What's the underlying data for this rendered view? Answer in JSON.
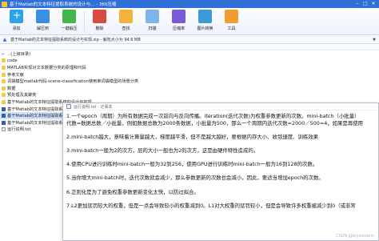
{
  "window": {
    "title": "基于Matlab的文本特征提取系统的设计与... - 360压缩",
    "controls": [
      "–",
      "□",
      "✕"
    ]
  },
  "toolbar": {
    "items": [
      {
        "label": "添加",
        "icon": "add-icon"
      },
      {
        "label": "解压到",
        "icon": "extract-icon"
      },
      {
        "label": "一键解压",
        "icon": "one-click-extract-icon"
      },
      {
        "label": "删除",
        "icon": "delete-icon"
      },
      {
        "label": "查找",
        "icon": "find-icon"
      },
      {
        "label": "扫描",
        "icon": "scan-icon"
      },
      {
        "label": "压缩率",
        "icon": "ratio-icon"
      },
      {
        "label": "图片转换",
        "icon": "image-convert-icon"
      },
      {
        "label": "工具",
        "icon": "tools-icon"
      }
    ]
  },
  "addressbar": {
    "text": "基于Matlab的文本特征提取系统的设计与实现.zip - 解包大小为 94.6 MB"
  },
  "files": [
    {
      "name": "..(上级目录)",
      "icon": "up-icon",
      "selected": false
    },
    {
      "name": "code",
      "icon": "folder-icon",
      "selected": false
    },
    {
      "name": "MATLAB实现对文本数据分类的原理和代码",
      "icon": "folder-icon",
      "selected": false
    },
    {
      "name": "参考文献",
      "icon": "folder-icon",
      "selected": false
    },
    {
      "name": "词袋模型matlab代码-scene-classification使用单词袋模型的场景分类",
      "icon": "folder-icon",
      "selected": false
    },
    {
      "name": "数据",
      "icon": "folder-icon",
      "selected": false
    },
    {
      "name": "预处理及其聚类",
      "icon": "folder-icon",
      "selected": false
    },
    {
      "name": "基于Matlab的文本特征提取系统的设计与实现",
      "icon": "folder-icon",
      "selected": false
    },
    {
      "name": "基于Matlab的文本特征提取系统的设计与实现 毕业论文.docx",
      "icon": "doc-icon",
      "selected": false
    },
    {
      "name": "基于Matlab的文本特征提取系统的设计与实现",
      "icon": "doc-icon",
      "selected": true
    },
    {
      "name": "基于Matlab的文本特征提取系统的设计与实现",
      "icon": "doc-icon",
      "selected": false
    },
    {
      "name": "运行说明.txt",
      "icon": "txt-icon",
      "selected": false
    }
  ],
  "notepad": {
    "title": "运行说明.txt - 记事本",
    "lines": [
      "1.一个epoch（周期）为所有数据完成一次前向与反向传播。iteration(迭代次数)为权重参数更新的次数。mini-batch（小批量）",
      "代数=数据总数／小批量，例如数据总数为2000条数据，小批量为500，那么一个周期内迭代次数=2000／500=4，如果是再使用",
      "",
      "2.mini-batch越大，意味着计算量越大，梯度越平滑，但不是越大越好，要根据内存大小、收敛速度、训练效果",
      "",
      "3.mini-batch一般为2的次方，层的大小一般也为2的次方，这是由硬件特性造成的。",
      "",
      "4.使用CPU进行训练时mini-batch一般为32到256，使用GPU进行训练时mini-batch一般为16到128的次数。",
      "",
      "5.当你增大mini-batch时，迭代次数就会减少，那么参数更新的次数也会减小，因此，要适当增加epoch的次数。",
      "",
      "6.正则化是为了避免权重参数更新变化太快，以防过拟合。",
      "",
      "7.L2更加惩罚较大的权重，但是一点会导致较小的权重减到0。L1对大权重的惩罚较小，但是会导致许多权重被减少到0（或非常"
    ]
  },
  "watermark": "CSDN @biyezuopin"
}
